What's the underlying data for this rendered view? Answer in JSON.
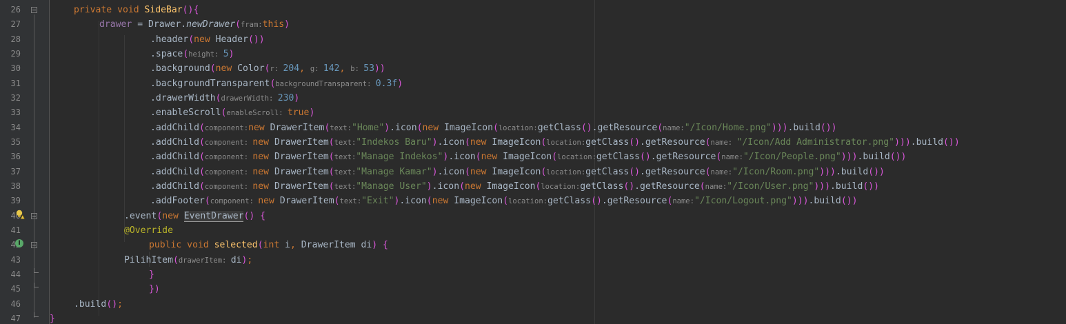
{
  "editor": {
    "colors": {
      "background": "#2b2b2b",
      "gutter": "#313335",
      "keyword": "#cc7832",
      "method": "#ffc66d",
      "field": "#9876aa",
      "string": "#6a8759",
      "number": "#6897bb",
      "hint": "#8c8c8c",
      "bracket": "#d957d9",
      "text": "#a9b7c6"
    },
    "gutter_icons": {
      "line_39": "intention-bulb-icon",
      "line_42": "implements-method-icon"
    },
    "lines": [
      {
        "number": "26",
        "tokens": [
          {
            "t": "kw",
            "v": "private void "
          },
          {
            "t": "fn",
            "v": "SideBar"
          },
          {
            "t": "paren",
            "v": "(){"
          }
        ]
      },
      {
        "number": "27",
        "tokens": [
          {
            "t": "field",
            "v": "drawer"
          },
          {
            "t": "plain",
            "v": " = Drawer."
          },
          {
            "t": "static",
            "v": "newDrawer"
          },
          {
            "t": "paren",
            "v": "("
          },
          {
            "t": "hint",
            "v": "fram:"
          },
          {
            "t": "kw",
            "v": "this"
          },
          {
            "t": "paren",
            "v": ")"
          }
        ]
      },
      {
        "number": "28",
        "tokens": [
          {
            "t": "plain",
            "v": ".header"
          },
          {
            "t": "paren",
            "v": "("
          },
          {
            "t": "kw",
            "v": "new "
          },
          {
            "t": "plain",
            "v": "Header"
          },
          {
            "t": "paren",
            "v": "())"
          }
        ]
      },
      {
        "number": "29",
        "tokens": [
          {
            "t": "plain",
            "v": ".space"
          },
          {
            "t": "paren",
            "v": "("
          },
          {
            "t": "hint",
            "v": "height: "
          },
          {
            "t": "num",
            "v": "5"
          },
          {
            "t": "paren",
            "v": ")"
          }
        ]
      },
      {
        "number": "30",
        "tokens": [
          {
            "t": "plain",
            "v": ".background"
          },
          {
            "t": "paren",
            "v": "("
          },
          {
            "t": "kw",
            "v": "new "
          },
          {
            "t": "plain",
            "v": "Color"
          },
          {
            "t": "paren",
            "v": "("
          },
          {
            "t": "hint",
            "v": "r: "
          },
          {
            "t": "num",
            "v": "204"
          },
          {
            "t": "kw",
            "v": ", "
          },
          {
            "t": "hint",
            "v": "g: "
          },
          {
            "t": "num",
            "v": "142"
          },
          {
            "t": "kw",
            "v": ", "
          },
          {
            "t": "hint",
            "v": "b: "
          },
          {
            "t": "num",
            "v": "53"
          },
          {
            "t": "paren",
            "v": "))"
          }
        ]
      },
      {
        "number": "31",
        "tokens": [
          {
            "t": "plain",
            "v": ".backgroundTransparent"
          },
          {
            "t": "paren",
            "v": "("
          },
          {
            "t": "hint",
            "v": "backgroundTransparent: "
          },
          {
            "t": "num",
            "v": "0.3f"
          },
          {
            "t": "paren",
            "v": ")"
          }
        ]
      },
      {
        "number": "32",
        "tokens": [
          {
            "t": "plain",
            "v": ".drawerWidth"
          },
          {
            "t": "paren",
            "v": "("
          },
          {
            "t": "hint",
            "v": "drawerWidth: "
          },
          {
            "t": "num",
            "v": "230"
          },
          {
            "t": "paren",
            "v": ")"
          }
        ]
      },
      {
        "number": "33",
        "tokens": [
          {
            "t": "plain",
            "v": ".enableScroll"
          },
          {
            "t": "paren",
            "v": "("
          },
          {
            "t": "hint",
            "v": "enableScroll: "
          },
          {
            "t": "kw",
            "v": "true"
          },
          {
            "t": "paren",
            "v": ")"
          }
        ]
      },
      {
        "number": "34",
        "tokens": [
          {
            "t": "plain",
            "v": ".addChild"
          },
          {
            "t": "paren",
            "v": "("
          },
          {
            "t": "hint",
            "v": "component:"
          },
          {
            "t": "kw",
            "v": "new "
          },
          {
            "t": "plain",
            "v": "DrawerItem"
          },
          {
            "t": "paren",
            "v": "("
          },
          {
            "t": "hint",
            "v": "text:"
          },
          {
            "t": "str",
            "v": "\"Home\""
          },
          {
            "t": "paren",
            "v": ")"
          },
          {
            "t": "plain",
            "v": ".icon"
          },
          {
            "t": "paren",
            "v": "("
          },
          {
            "t": "kw",
            "v": "new "
          },
          {
            "t": "plain",
            "v": "ImageIcon"
          },
          {
            "t": "paren",
            "v": "("
          },
          {
            "t": "hint",
            "v": "location:"
          },
          {
            "t": "plain",
            "v": "getClass"
          },
          {
            "t": "paren",
            "v": "()"
          },
          {
            "t": "plain",
            "v": ".getResource"
          },
          {
            "t": "paren",
            "v": "("
          },
          {
            "t": "hint",
            "v": "name:"
          },
          {
            "t": "str",
            "v": "\"/Icon/Home.png\""
          },
          {
            "t": "paren",
            "v": ")))"
          },
          {
            "t": "plain",
            "v": ".build"
          },
          {
            "t": "paren",
            "v": "())"
          }
        ]
      },
      {
        "number": "35",
        "tokens": [
          {
            "t": "plain",
            "v": ".addChild"
          },
          {
            "t": "paren",
            "v": "("
          },
          {
            "t": "hint",
            "v": "component: "
          },
          {
            "t": "kw",
            "v": "new "
          },
          {
            "t": "plain",
            "v": "DrawerItem"
          },
          {
            "t": "paren",
            "v": "("
          },
          {
            "t": "hint",
            "v": "text:"
          },
          {
            "t": "str",
            "v": "\"Indekos Baru\""
          },
          {
            "t": "paren",
            "v": ")"
          },
          {
            "t": "plain",
            "v": ".icon"
          },
          {
            "t": "paren",
            "v": "("
          },
          {
            "t": "kw",
            "v": "new "
          },
          {
            "t": "plain",
            "v": "ImageIcon"
          },
          {
            "t": "paren",
            "v": "("
          },
          {
            "t": "hint",
            "v": "location:"
          },
          {
            "t": "plain",
            "v": "getClass"
          },
          {
            "t": "paren",
            "v": "()"
          },
          {
            "t": "plain",
            "v": ".getResource"
          },
          {
            "t": "paren",
            "v": "("
          },
          {
            "t": "hint",
            "v": "name: "
          },
          {
            "t": "str",
            "v": "\"/Icon/Add Administrator.png\""
          },
          {
            "t": "paren",
            "v": ")))"
          },
          {
            "t": "plain",
            "v": ".build"
          },
          {
            "t": "paren",
            "v": "())"
          }
        ]
      },
      {
        "number": "36",
        "tokens": [
          {
            "t": "plain",
            "v": ".addChild"
          },
          {
            "t": "paren",
            "v": "("
          },
          {
            "t": "hint",
            "v": "component: "
          },
          {
            "t": "kw",
            "v": "new "
          },
          {
            "t": "plain",
            "v": "DrawerItem"
          },
          {
            "t": "paren",
            "v": "("
          },
          {
            "t": "hint",
            "v": "text:"
          },
          {
            "t": "str",
            "v": "\"Manage Indekos\""
          },
          {
            "t": "paren",
            "v": ")"
          },
          {
            "t": "plain",
            "v": ".icon"
          },
          {
            "t": "paren",
            "v": "("
          },
          {
            "t": "kw",
            "v": "new "
          },
          {
            "t": "plain",
            "v": "ImageIcon"
          },
          {
            "t": "paren",
            "v": "("
          },
          {
            "t": "hint",
            "v": "location:"
          },
          {
            "t": "plain",
            "v": "getClass"
          },
          {
            "t": "paren",
            "v": "()"
          },
          {
            "t": "plain",
            "v": ".getResource"
          },
          {
            "t": "paren",
            "v": "("
          },
          {
            "t": "hint",
            "v": "name:"
          },
          {
            "t": "str",
            "v": "\"/Icon/People.png\""
          },
          {
            "t": "paren",
            "v": ")))"
          },
          {
            "t": "plain",
            "v": ".build"
          },
          {
            "t": "paren",
            "v": "())"
          }
        ]
      },
      {
        "number": "37",
        "tokens": [
          {
            "t": "plain",
            "v": ".addChild"
          },
          {
            "t": "paren",
            "v": "("
          },
          {
            "t": "hint",
            "v": "component: "
          },
          {
            "t": "kw",
            "v": "new "
          },
          {
            "t": "plain",
            "v": "DrawerItem"
          },
          {
            "t": "paren",
            "v": "("
          },
          {
            "t": "hint",
            "v": "text:"
          },
          {
            "t": "str",
            "v": "\"Manage Kamar\""
          },
          {
            "t": "paren",
            "v": ")"
          },
          {
            "t": "plain",
            "v": ".icon"
          },
          {
            "t": "paren",
            "v": "("
          },
          {
            "t": "kw",
            "v": "new "
          },
          {
            "t": "plain",
            "v": "ImageIcon"
          },
          {
            "t": "paren",
            "v": "("
          },
          {
            "t": "hint",
            "v": "location:"
          },
          {
            "t": "plain",
            "v": "getClass"
          },
          {
            "t": "paren",
            "v": "()"
          },
          {
            "t": "plain",
            "v": ".getResource"
          },
          {
            "t": "paren",
            "v": "("
          },
          {
            "t": "hint",
            "v": "name:"
          },
          {
            "t": "str",
            "v": "\"/Icon/Room.png\""
          },
          {
            "t": "paren",
            "v": ")))"
          },
          {
            "t": "plain",
            "v": ".build"
          },
          {
            "t": "paren",
            "v": "())"
          }
        ]
      },
      {
        "number": "38",
        "tokens": [
          {
            "t": "plain",
            "v": ".addChild"
          },
          {
            "t": "paren",
            "v": "("
          },
          {
            "t": "hint",
            "v": "component: "
          },
          {
            "t": "kw",
            "v": "new "
          },
          {
            "t": "plain",
            "v": "DrawerItem"
          },
          {
            "t": "paren",
            "v": "("
          },
          {
            "t": "hint",
            "v": "text:"
          },
          {
            "t": "str",
            "v": "\"Manage User\""
          },
          {
            "t": "paren",
            "v": ")"
          },
          {
            "t": "plain",
            "v": ".icon"
          },
          {
            "t": "paren",
            "v": "("
          },
          {
            "t": "kw",
            "v": "new "
          },
          {
            "t": "plain",
            "v": "ImageIcon"
          },
          {
            "t": "paren",
            "v": "("
          },
          {
            "t": "hint",
            "v": "location:"
          },
          {
            "t": "plain",
            "v": "getClass"
          },
          {
            "t": "paren",
            "v": "()"
          },
          {
            "t": "plain",
            "v": ".getResource"
          },
          {
            "t": "paren",
            "v": "("
          },
          {
            "t": "hint",
            "v": "name:"
          },
          {
            "t": "str",
            "v": "\"/Icon/User.png\""
          },
          {
            "t": "paren",
            "v": ")))"
          },
          {
            "t": "plain",
            "v": ".build"
          },
          {
            "t": "paren",
            "v": "())"
          }
        ]
      },
      {
        "number": "39",
        "tokens": [
          {
            "t": "plain",
            "v": ".addFooter"
          },
          {
            "t": "paren",
            "v": "("
          },
          {
            "t": "hint",
            "v": "component: "
          },
          {
            "t": "kw",
            "v": "new "
          },
          {
            "t": "plain",
            "v": "DrawerItem"
          },
          {
            "t": "paren",
            "v": "("
          },
          {
            "t": "hint",
            "v": "text:"
          },
          {
            "t": "str",
            "v": "\"Exit\""
          },
          {
            "t": "paren",
            "v": ")"
          },
          {
            "t": "plain",
            "v": ".icon"
          },
          {
            "t": "paren",
            "v": "("
          },
          {
            "t": "kw",
            "v": "new "
          },
          {
            "t": "plain",
            "v": "ImageIcon"
          },
          {
            "t": "paren",
            "v": "("
          },
          {
            "t": "hint",
            "v": "location:"
          },
          {
            "t": "plain",
            "v": "getClass"
          },
          {
            "t": "paren",
            "v": "()"
          },
          {
            "t": "plain",
            "v": ".getResource"
          },
          {
            "t": "paren",
            "v": "("
          },
          {
            "t": "hint",
            "v": "name:"
          },
          {
            "t": "str",
            "v": "\"/Icon/Logout.png\""
          },
          {
            "t": "paren",
            "v": ")))"
          },
          {
            "t": "plain",
            "v": ".build"
          },
          {
            "t": "paren",
            "v": "())"
          }
        ]
      },
      {
        "number": "40",
        "tokens": [
          {
            "t": "plain",
            "v": ".event"
          },
          {
            "t": "paren",
            "v": "("
          },
          {
            "t": "kw",
            "v": "new "
          },
          {
            "t": "hl",
            "v": "EventDrawer"
          },
          {
            "t": "paren",
            "v": "() {"
          }
        ]
      },
      {
        "number": "41",
        "tokens": [
          {
            "t": "ann",
            "v": "@Override"
          }
        ]
      },
      {
        "number": "42",
        "tokens": [
          {
            "t": "kw",
            "v": "public void "
          },
          {
            "t": "fn",
            "v": "selected"
          },
          {
            "t": "paren",
            "v": "("
          },
          {
            "t": "kw",
            "v": "int "
          },
          {
            "t": "plain",
            "v": "i"
          },
          {
            "t": "kw",
            "v": ", "
          },
          {
            "t": "plain",
            "v": "DrawerItem di"
          },
          {
            "t": "paren",
            "v": ") {"
          }
        ]
      },
      {
        "number": "43",
        "tokens": [
          {
            "t": "plain",
            "v": "PilihItem"
          },
          {
            "t": "paren",
            "v": "("
          },
          {
            "t": "hint",
            "v": "drawerItem: "
          },
          {
            "t": "plain",
            "v": "di"
          },
          {
            "t": "paren",
            "v": ")"
          },
          {
            "t": "kw",
            "v": ";"
          }
        ]
      },
      {
        "number": "44",
        "tokens": [
          {
            "t": "paren",
            "v": "}"
          }
        ]
      },
      {
        "number": "45",
        "tokens": [
          {
            "t": "paren",
            "v": "})"
          }
        ]
      },
      {
        "number": "46",
        "tokens": [
          {
            "t": "plain",
            "v": ".build"
          },
          {
            "t": "paren",
            "v": "()"
          },
          {
            "t": "kw",
            "v": ";"
          }
        ]
      },
      {
        "number": "47",
        "tokens": [
          {
            "t": "paren",
            "v": "}"
          }
        ]
      }
    ]
  }
}
